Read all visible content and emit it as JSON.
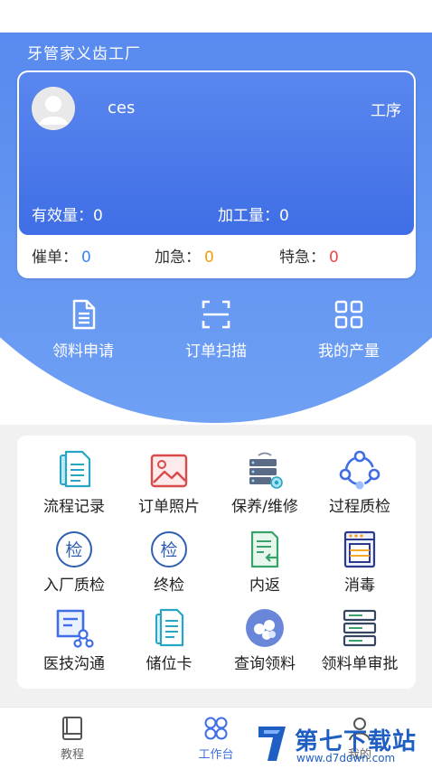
{
  "app": {
    "title": "牙管家义齿工厂"
  },
  "user": {
    "name": "ces",
    "process_label": "工序"
  },
  "stats": {
    "valid_label": "有效量：",
    "valid_value": "0",
    "processing_label": "加工量：",
    "processing_value": "0"
  },
  "urgency": {
    "remind_label": "催单：",
    "remind_value": "0",
    "remind_color": "#3b82f6",
    "rush_label": "加急：",
    "rush_value": "0",
    "rush_color": "#f59e0b",
    "special_label": "特急：",
    "special_value": "0",
    "special_color": "#ef4444"
  },
  "quick_actions": [
    {
      "label": "领料申请",
      "icon": "document-icon"
    },
    {
      "label": "订单扫描",
      "icon": "scan-icon"
    },
    {
      "label": "我的产量",
      "icon": "grid-icon"
    }
  ],
  "grid": [
    {
      "label": "流程记录",
      "icon": "process-record-icon"
    },
    {
      "label": "订单照片",
      "icon": "photo-icon"
    },
    {
      "label": "保养/维修",
      "icon": "server-maintenance-icon"
    },
    {
      "label": "过程质检",
      "icon": "cycle-check-icon"
    },
    {
      "label": "入厂质检",
      "icon": "inspect-circle-icon"
    },
    {
      "label": "终检",
      "icon": "inspect-circle-icon"
    },
    {
      "label": "内返",
      "icon": "return-doc-icon"
    },
    {
      "label": "消毒",
      "icon": "oven-icon"
    },
    {
      "label": "医技沟通",
      "icon": "communication-icon"
    },
    {
      "label": "储位卡",
      "icon": "storage-card-icon"
    },
    {
      "label": "查询领料",
      "icon": "query-material-icon"
    },
    {
      "label": "领料单审批",
      "icon": "approval-icon"
    }
  ],
  "inspect_glyph": "检",
  "tabbar": [
    {
      "label": "教程",
      "icon": "book-icon",
      "active": false
    },
    {
      "label": "工作台",
      "icon": "workbench-icon",
      "active": true
    },
    {
      "label": "我的",
      "icon": "user-icon",
      "active": false
    }
  ],
  "watermark": {
    "text": "第七下载站",
    "url": "www.d7down.com"
  },
  "colors": {
    "primary": "#3f6ee6",
    "accent": "#5b8df0"
  }
}
